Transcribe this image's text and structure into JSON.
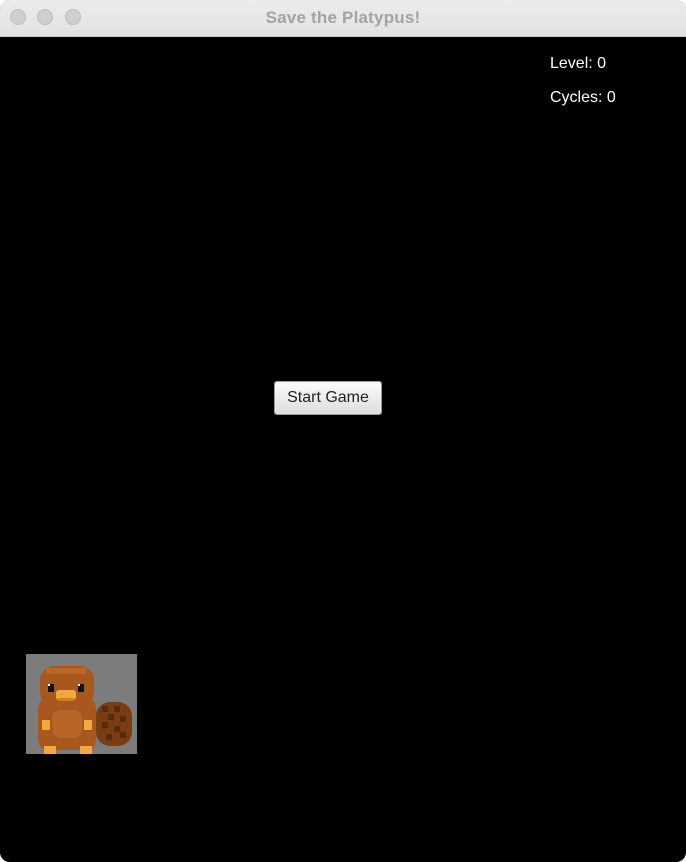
{
  "window": {
    "title": "Save the Platypus!"
  },
  "hud": {
    "level_text": "Level: 0",
    "cycles_text": "Cycles: 0"
  },
  "start_button": {
    "label": "Start Game"
  },
  "player": {
    "icon": "platypus-sprite"
  },
  "colors": {
    "background": "#000000",
    "hud_text": "#ffffff",
    "sprite_backdrop": "#7c7c7c",
    "platypus_body": "#a8581f",
    "platypus_bill": "#f0a93a"
  }
}
